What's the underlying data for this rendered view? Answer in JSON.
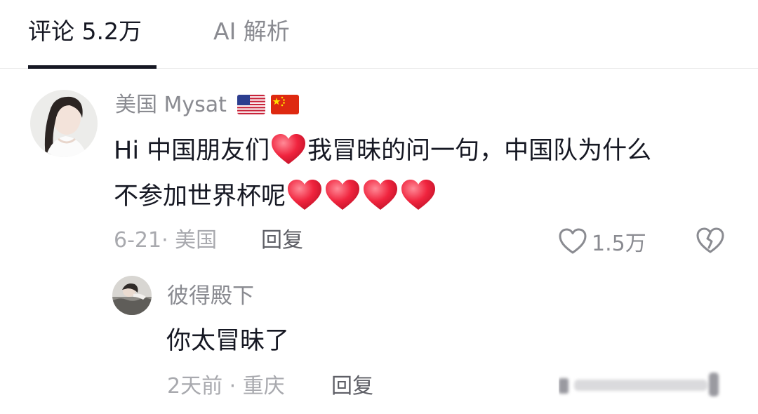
{
  "tabs": {
    "comments_label": "评论 5.2万",
    "ai_label": "AI 解析"
  },
  "comment": {
    "username": "美国 Mysat",
    "flags": [
      "us-flag-icon",
      "china-flag-icon"
    ],
    "text_line1_part1": "Hi 中国朋友们",
    "text_line1_part2": "我冒昧的问一句，中国队为什么",
    "text_line2": "不参加世界杯呢",
    "hearts_count": 4,
    "date_location": "6-21· 美国",
    "reply_label": "回复",
    "like_count": "1.5万"
  },
  "reply": {
    "username": "彼得殿下",
    "text": "你太冒昧了",
    "date_location": "2天前 · 重庆",
    "reply_label": "回复"
  },
  "colors": {
    "primary_text": "#161823",
    "secondary_text": "#8a8b91",
    "heart_red": "#f0243e"
  }
}
